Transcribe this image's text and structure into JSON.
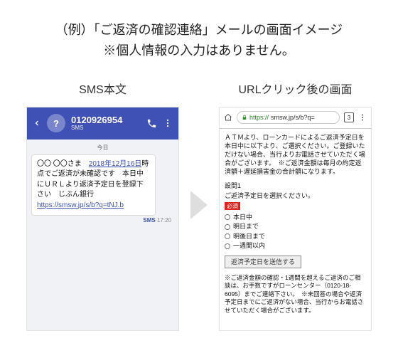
{
  "heading_line1": "（例）「ご返済の確認連絡」メールの画面イメージ",
  "heading_line2": "※個人情報の入力はありません。",
  "left": {
    "label": "SMS本文",
    "avatar": "?",
    "phone_number": "0120926954",
    "sub": "SMS",
    "today": "今日",
    "msg_pre": "〇〇 〇〇さま　",
    "msg_date": "2018年12月16日",
    "msg_post": "時点でご返済が未確認です　本日中にＵＲＬより返済予定日を登録下さい　じぶん銀行",
    "msg_link": "https://smsw.jp/s/b?q=tNJ.b",
    "time_label": "SMS",
    "time": "17:20"
  },
  "right": {
    "label": "URLクリック後の画面",
    "url_proto": "https://",
    "url_rest": "smsw.jp/s/b?q=",
    "tab_count": "3",
    "para1": "ＡＴＭより、ローンカードによるご返済予定日を本日中に以下より、ご選択ください。ご登録いただけない場合、当行よりお電話させていただく場合がございます。　※ご返済金額は毎月の約定返済額＋遅延損害金の合計額になります。",
    "q_no": "設問1",
    "q_text": "ご返済予定日を選択ください。",
    "req": "必須",
    "opts": [
      "本日中",
      "明日まで",
      "明後日まで",
      "一週間以内"
    ],
    "submit": "返済予定日を送信する",
    "note": "※ご返済金額の確認・1週間を超えるご返済のご相談は、お手数ですがローンセンター（0120-18-6095）までご連絡下さい。　※未回答の場合や返済予定日までにご返済がない場合、当行からお電話させていただく場合がございます。"
  }
}
